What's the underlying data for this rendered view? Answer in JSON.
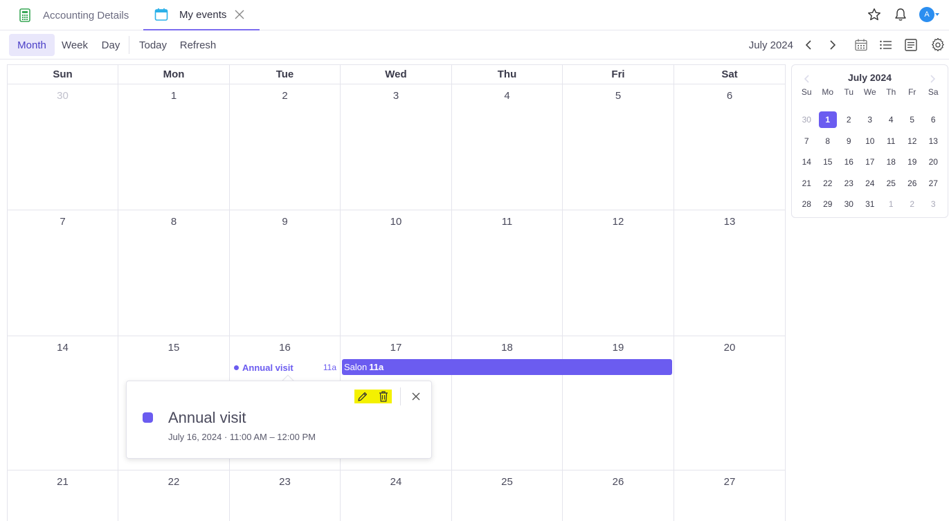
{
  "tabs": [
    {
      "label": "Accounting Details",
      "icon": "calculator-icon"
    },
    {
      "label": "My events",
      "icon": "calendar-icon",
      "active": true
    }
  ],
  "user": {
    "avatar_letter": "A"
  },
  "toolbar": {
    "month": "Month",
    "week": "Week",
    "day": "Day",
    "today": "Today",
    "refresh": "Refresh",
    "current_month": "July 2024"
  },
  "weekdays": [
    "Sun",
    "Mon",
    "Tue",
    "Wed",
    "Thu",
    "Fri",
    "Sat"
  ],
  "weeks": [
    [
      {
        "d": "30",
        "dim": true
      },
      {
        "d": "1"
      },
      {
        "d": "2"
      },
      {
        "d": "3"
      },
      {
        "d": "4"
      },
      {
        "d": "5"
      },
      {
        "d": "6"
      }
    ],
    [
      {
        "d": "7"
      },
      {
        "d": "8"
      },
      {
        "d": "9"
      },
      {
        "d": "10"
      },
      {
        "d": "11"
      },
      {
        "d": "12"
      },
      {
        "d": "13"
      }
    ],
    [
      {
        "d": "14"
      },
      {
        "d": "15"
      },
      {
        "d": "16"
      },
      {
        "d": "17"
      },
      {
        "d": "18"
      },
      {
        "d": "19"
      },
      {
        "d": "20"
      }
    ],
    [
      {
        "d": "21"
      },
      {
        "d": "22"
      },
      {
        "d": "23"
      },
      {
        "d": "24"
      },
      {
        "d": "25"
      },
      {
        "d": "26"
      },
      {
        "d": "27"
      }
    ]
  ],
  "events": {
    "annual_visit": {
      "title": "Annual visit",
      "time": "11a"
    },
    "salon": {
      "title": "Salon",
      "time": "11a"
    }
  },
  "popup": {
    "title": "Annual visit",
    "datetime": "July 16, 2024 · 11:00 AM – 12:00 PM",
    "color": "#6b5cf0"
  },
  "mini_calendar": {
    "title": "July 2024",
    "dow": [
      "Su",
      "Mo",
      "Tu",
      "We",
      "Th",
      "Fr",
      "Sa"
    ],
    "weeks": [
      [
        {
          "d": "30",
          "dim": true
        },
        {
          "d": "1",
          "sel": true
        },
        {
          "d": "2"
        },
        {
          "d": "3"
        },
        {
          "d": "4"
        },
        {
          "d": "5"
        },
        {
          "d": "6"
        }
      ],
      [
        {
          "d": "7"
        },
        {
          "d": "8"
        },
        {
          "d": "9"
        },
        {
          "d": "10"
        },
        {
          "d": "11"
        },
        {
          "d": "12"
        },
        {
          "d": "13"
        }
      ],
      [
        {
          "d": "14"
        },
        {
          "d": "15"
        },
        {
          "d": "16"
        },
        {
          "d": "17"
        },
        {
          "d": "18"
        },
        {
          "d": "19"
        },
        {
          "d": "20"
        }
      ],
      [
        {
          "d": "21"
        },
        {
          "d": "22"
        },
        {
          "d": "23"
        },
        {
          "d": "24"
        },
        {
          "d": "25"
        },
        {
          "d": "26"
        },
        {
          "d": "27"
        }
      ],
      [
        {
          "d": "28"
        },
        {
          "d": "29"
        },
        {
          "d": "30"
        },
        {
          "d": "31"
        },
        {
          "d": "1",
          "dim": true
        },
        {
          "d": "2",
          "dim": true
        },
        {
          "d": "3",
          "dim": true
        }
      ]
    ]
  },
  "colors": {
    "accent": "#6b5cf0",
    "highlight": "#f4f100"
  }
}
